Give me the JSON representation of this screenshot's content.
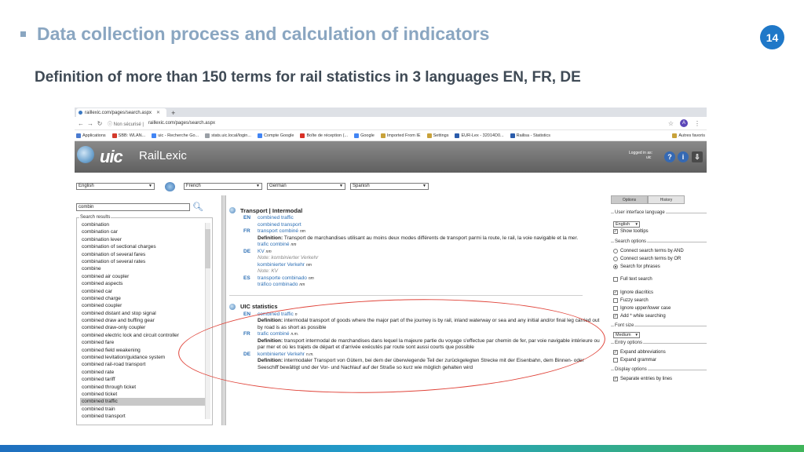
{
  "slide": {
    "title": "Data collection process and calculation of indicators",
    "page_number": "14",
    "subtitle": "Definition of more than 150 terms for rail statistics in 3 languages EN, FR, DE"
  },
  "browser": {
    "tab_title": "raillexic.com/pages/search.aspx",
    "security_label": "Non sécurisé",
    "url": "raillexic.com/pages/search.aspx",
    "profile_initial": "A",
    "bookmarks": [
      "Applications",
      "SBB: WLAN...",
      "uic - Recherche Go...",
      "stats.uic.local/login...",
      "Compte Google",
      "Boîte de réception (...",
      "Google",
      "Imported From IE",
      "Settings",
      "EUR-Lex - 32014D0...",
      "Railisa - Statistics",
      "Autres favoris"
    ]
  },
  "site": {
    "brand_logo": "uic",
    "brand_name": "RailLexic",
    "logged_in_label": "Logged in as:",
    "logged_in_user": "uic",
    "languages": [
      "English",
      "French",
      "German",
      "Spanish"
    ],
    "search_value": "combin",
    "results_label": "Search results",
    "results": [
      "combination",
      "combination car",
      "combination lever",
      "combination of sectional charges",
      "combination of several fares",
      "combination of several rates",
      "combine",
      "combined air coupler",
      "combined aspects",
      "combined car",
      "combined charge",
      "combined coupler",
      "combined distant and stop signal",
      "combined draw and buffing gear",
      "combined draw-only coupler",
      "combined electric lock and circuit controller",
      "combined fare",
      "combined field weakening",
      "combined levitation/guidance system",
      "combined rail-road transport",
      "combined rate",
      "combined tariff",
      "combined through ticket",
      "combined ticket",
      "combined traffic",
      "combined train",
      "combined transport"
    ],
    "selected_result": "combined traffic"
  },
  "entries": {
    "e1": {
      "heading": "Transport | Intermodal",
      "en_code": "EN",
      "en_term1": "combined traffic",
      "en_term2": "combined transport",
      "fr_code": "FR",
      "fr_term1": "transport combiné",
      "fr_pos1": "nm",
      "def_label": "Definition:",
      "fr_def": "Transport de marchandises utilisant au moins deux modes différents de transport parmi la route, le rail, la voie navigable et la mer.",
      "fr_term2": "trafic combiné",
      "fr_pos2": "nm",
      "de_code": "DE",
      "de_term1": "KV",
      "de_pos1": "nm",
      "de_note1": "Note: kombinierter Verkehr",
      "de_term2": "kombinierter Verkehr",
      "de_pos2": "nm",
      "de_note2": "Note: KV",
      "es_code": "ES",
      "es_term1": "transporte combinado",
      "es_pos1": "nm",
      "es_term2": "tráfico combinado",
      "es_pos2": "nm"
    },
    "e2": {
      "heading": "UIC statistics",
      "en_code": "EN",
      "en_term": "combined traffic",
      "en_pos": "n",
      "def_label": "Definition:",
      "en_def": "intermodal transport of goods where the major part of the journey is by rail, inland waterway or sea and any initial and/or final leg carried out by road is as short as possible",
      "fr_code": "FR",
      "fr_term": "trafic combiné",
      "fr_pos": "n.m.",
      "fr_def": "transport intermodal de marchandises dans lequel la majeure partie du voyage s'effectue par chemin de fer, par voie navigable intérieure ou par mer et où les trajets de départ et d'arrivée exécutés par route sont aussi courts que possible",
      "de_code": "DE",
      "de_term": "kombinierter Verkehr",
      "de_pos": "n.m.",
      "de_def": "intermodaler Transport von Gütern, bei dem der überwiegende Teil der zurückgelegten Strecke mit der Eisenbahn, dem Binnen- oder Seeschiff bewältigt und der Vor- und Nachlauf auf der Straße so kurz wie möglich gehalten wird"
    }
  },
  "panel": {
    "tab_options": "Options",
    "tab_history": "History",
    "ui_lang_label": "User interface language",
    "ui_lang_value": "English",
    "show_tooltips": "Show tooltips",
    "search_options_label": "Search options",
    "opt_and": "Connect search terms by AND",
    "opt_or": "Connect search terms by OR",
    "opt_phrases": "Search for phrases",
    "full_text": "Full text search",
    "ignore_diacritics": "Ignore diacritics",
    "fuzzy": "Fuzzy search",
    "ignore_case": "Ignore upper/lower case",
    "add_star": "Add * while searching",
    "font_size_label": "Font size",
    "font_size_value": "Medium",
    "entry_options_label": "Entry options",
    "expand_abbr": "Expand abbreviations",
    "expand_grammar": "Expand grammar",
    "display_options_label": "Display options",
    "separate_entries": "Separate entries by lines"
  }
}
